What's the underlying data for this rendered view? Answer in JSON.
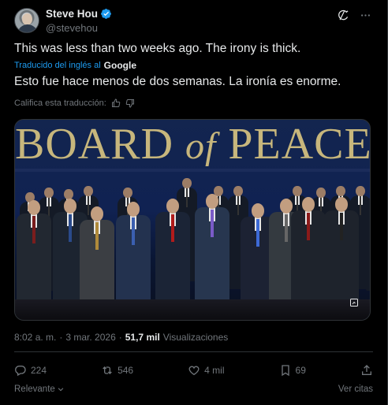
{
  "author": {
    "name": "Steve Hou",
    "handle": "@stevehou"
  },
  "tweet": {
    "text_original": "This was less than two weeks ago. The irony is thick.",
    "translated_label": "Traducido del inglés al",
    "translator": "Google",
    "text_translated": "Esto fue hace menos de dos semanas. La ironía es enorme.",
    "rate_label": "Califica esta traducción:"
  },
  "media": {
    "banner_word1": "BOARD",
    "banner_word2": "of",
    "banner_word3": "PEACE"
  },
  "meta": {
    "time": "8:02 a. m.",
    "sep": "·",
    "date": "3 mar. 2026",
    "sep2": "·",
    "views_count": "51,7 mil",
    "views_label": "Visualizaciones"
  },
  "actions": {
    "replies": "224",
    "reposts": "546",
    "likes": "4 mil",
    "bookmarks": "69"
  },
  "footer": {
    "sort_label": "Relevante",
    "quotes_label": "Ver citas"
  },
  "colors": {
    "accent": "#1d9bf0",
    "muted": "#71767b",
    "banner": "#c7b67c"
  }
}
